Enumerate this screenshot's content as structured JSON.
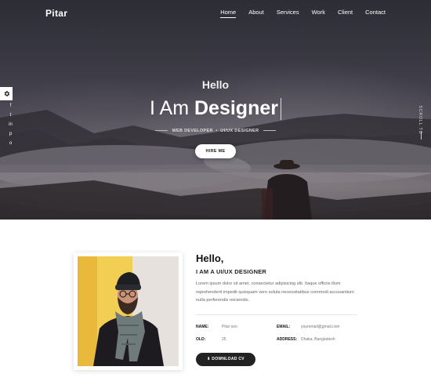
{
  "brand": {
    "name": "Pitar"
  },
  "nav": {
    "items": [
      {
        "label": "Home",
        "active": true
      },
      {
        "label": "About"
      },
      {
        "label": "Services"
      },
      {
        "label": "Work"
      },
      {
        "label": "Client"
      },
      {
        "label": "Contact"
      }
    ]
  },
  "hero": {
    "greeting": "Hello",
    "headline_prefix": "I Am ",
    "headline_strong": "Designer",
    "role_1": "WEB DEVELOPER",
    "separator": "•",
    "role_2": "UI/UX DESIGNER",
    "cta_label": "HIRE ME",
    "scroll_label": "SCROLL TO"
  },
  "sidebar": {
    "settings_icon": "gear-icon",
    "social_icons": [
      "facebook-icon",
      "twitter-icon",
      "linkedin-icon",
      "pinterest-icon",
      "instagram-icon"
    ],
    "social_glyphs": [
      "f",
      "t",
      "in",
      "p",
      "o"
    ]
  },
  "about": {
    "title": "Hello,",
    "role": "I AM A UI/UX DESIGNER",
    "description": "Lorem ipsum dolor sit amet, consectetur adipisicing elit. Itaque officiis illum reprehenderit impedit quisquam vero soluta necessitatibus commodi accusantium nulla perferendis reiciendis.",
    "info": {
      "name_label": "NAME:",
      "name_value": "Pitar son",
      "old_label": "OLD:",
      "old_value": "25",
      "email_label": "EMAIL:",
      "email_value": "youremail@gmail.com",
      "address_label": "ADDRESS:",
      "address_value": "Dhaka, Bangladesh"
    },
    "download_icon": "download-icon",
    "download_label": "DOWNLOAD CV"
  }
}
